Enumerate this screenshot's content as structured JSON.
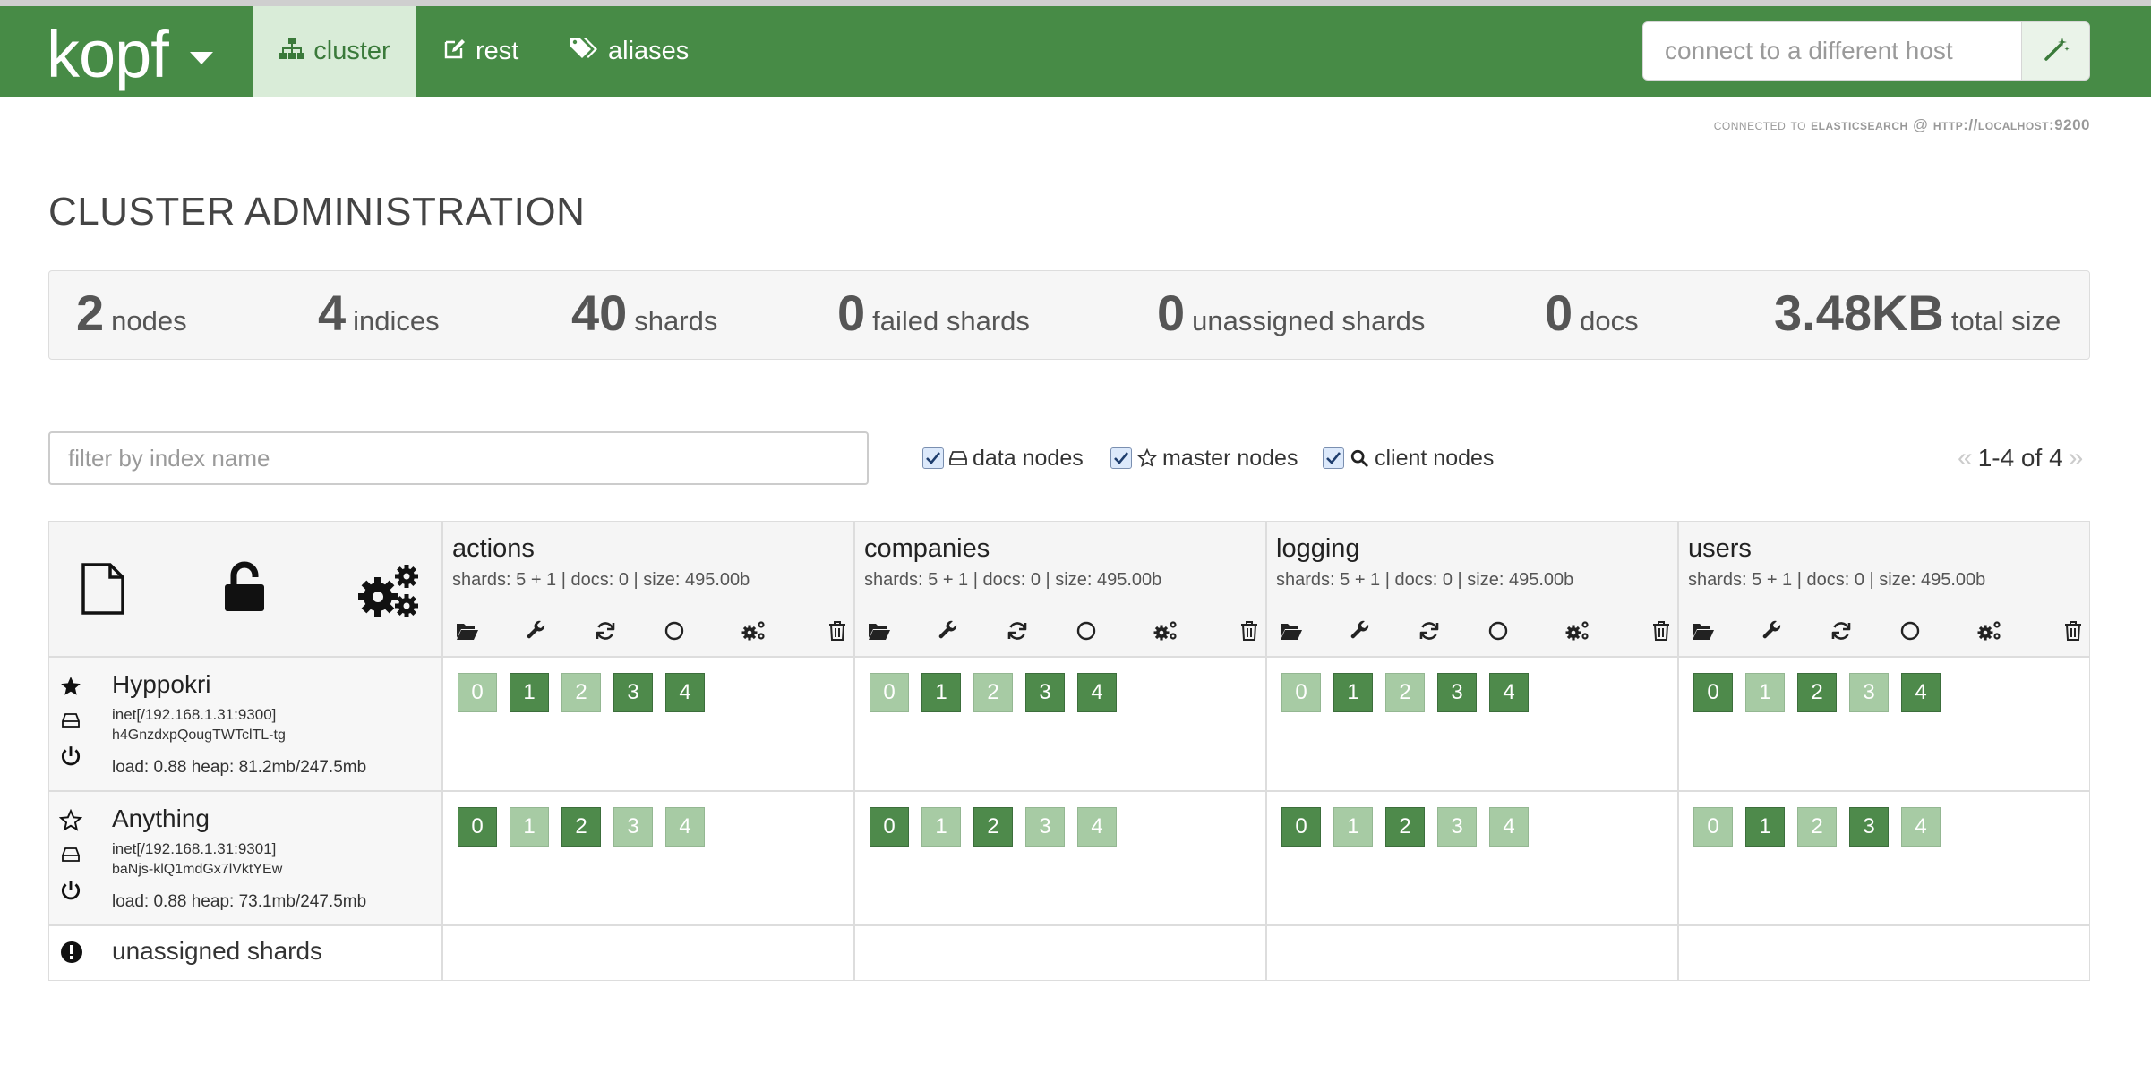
{
  "navbar": {
    "brand": "kopf",
    "links": [
      {
        "label": "cluster",
        "icon": "sitemap-icon",
        "active": true
      },
      {
        "label": "rest",
        "icon": "edit-icon",
        "active": false
      },
      {
        "label": "aliases",
        "icon": "tags-icon",
        "active": false
      }
    ],
    "host_placeholder": "connect to a different host",
    "host_button_icon": "magic-wand-icon"
  },
  "connection": {
    "prefix": "connected to",
    "service": "elasticsearch",
    "at": "@",
    "url": "http://localhost:9200"
  },
  "page_title": "CLUSTER ADMINISTRATION",
  "stats": [
    {
      "value": "2",
      "label": "nodes"
    },
    {
      "value": "4",
      "label": "indices"
    },
    {
      "value": "40",
      "label": "shards"
    },
    {
      "value": "0",
      "label": "failed shards"
    },
    {
      "value": "0",
      "label": "unassigned shards"
    },
    {
      "value": "0",
      "label": "docs"
    },
    {
      "value": "3.48KB",
      "label": "total size"
    }
  ],
  "filters": {
    "index_placeholder": "filter by index name",
    "data_nodes": {
      "label": "data nodes",
      "checked": true
    },
    "master_nodes": {
      "label": "master nodes",
      "checked": true
    },
    "client_nodes": {
      "label": "client nodes",
      "checked": true
    },
    "pagination": "1-4 of 4",
    "prev": "«",
    "next": "»"
  },
  "header_actions": [
    "new-index-icon",
    "unlock-icon",
    "settings-icon"
  ],
  "index_tools": [
    "open-folder-icon",
    "wrench-icon",
    "refresh-icon",
    "circle-icon",
    "settings-icon",
    "trash-icon"
  ],
  "indices": [
    {
      "name": "actions",
      "stats": "shards: 5 + 1 | docs: 0 | size: 495.00b"
    },
    {
      "name": "companies",
      "stats": "shards: 5 + 1 | docs: 0 | size: 495.00b"
    },
    {
      "name": "logging",
      "stats": "shards: 5 + 1 | docs: 0 | size: 495.00b"
    },
    {
      "name": "users",
      "stats": "shards: 5 + 1 | docs: 0 | size: 495.00b"
    }
  ],
  "nodes": [
    {
      "name": "Hyppokri",
      "master": true,
      "address": "inet[/192.168.1.31:9300]",
      "id": "h4GnzdxpQougTWTclTL-tg",
      "load": "load: 0.88  heap: 81.2mb/247.5mb",
      "shards": [
        [
          "replica",
          "primary",
          "replica",
          "primary",
          "primary"
        ],
        [
          "replica",
          "primary",
          "replica",
          "primary",
          "primary"
        ],
        [
          "replica",
          "primary",
          "replica",
          "primary",
          "primary"
        ],
        [
          "primary",
          "replica",
          "primary",
          "replica",
          "primary"
        ]
      ]
    },
    {
      "name": "Anything",
      "master": false,
      "address": "inet[/192.168.1.31:9301]",
      "id": "baNjs-klQ1mdGx7lVktYEw",
      "load": "load: 0.88  heap: 73.1mb/247.5mb",
      "shards": [
        [
          "primary",
          "replica",
          "primary",
          "replica",
          "replica"
        ],
        [
          "primary",
          "replica",
          "primary",
          "replica",
          "replica"
        ],
        [
          "primary",
          "replica",
          "primary",
          "replica",
          "replica"
        ],
        [
          "replica",
          "primary",
          "replica",
          "primary",
          "replica"
        ]
      ]
    }
  ],
  "shard_numbers": [
    "0",
    "1",
    "2",
    "3",
    "4"
  ],
  "unassigned": {
    "label": "unassigned shards",
    "icon": "exclamation-icon"
  },
  "colors": {
    "navbar": "#478b46",
    "primary_shard": "#4e8a4b",
    "replica_shard": "#a7cba4"
  }
}
